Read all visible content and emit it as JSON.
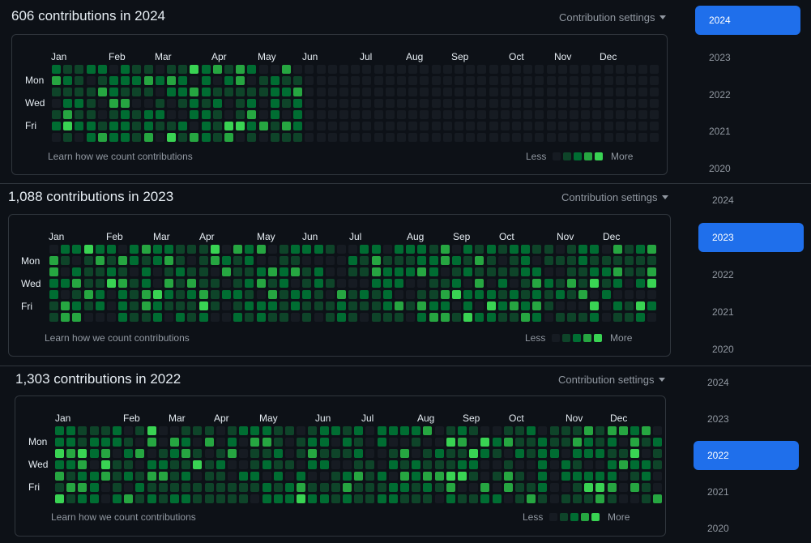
{
  "colors": {
    "accent": "#1f6feb",
    "levels": [
      "#161b22",
      "#0e4429",
      "#006d32",
      "#26a641",
      "#39d353"
    ]
  },
  "months": [
    "Jan",
    "Feb",
    "Mar",
    "Apr",
    "May",
    "Jun",
    "Jul",
    "Aug",
    "Sep",
    "Oct",
    "Nov",
    "Dec"
  ],
  "day_labels": [
    "Mon",
    "Wed",
    "Fri"
  ],
  "learn_link": "Learn how we count contributions",
  "legend": {
    "less": "Less",
    "more": "More"
  },
  "settings_label": "Contribution settings",
  "sections": [
    {
      "title": "606 contributions in 2024",
      "years": [
        "2024",
        "2023",
        "2022",
        "2021",
        "2020"
      ],
      "selected_year": "2024",
      "grid_seed": 11,
      "active_weeks": 22
    },
    {
      "title": "1,088 contributions in 2023",
      "years": [
        "2024",
        "2023",
        "2022",
        "2021",
        "2020"
      ],
      "selected_year": "2023",
      "grid_seed": 23,
      "active_weeks": 53
    },
    {
      "title": "1,303 contributions in 2022",
      "years": [
        "2024",
        "2023",
        "2022",
        "2021",
        "2020"
      ],
      "selected_year": "2022",
      "grid_seed": 37,
      "active_weeks": 53
    }
  ]
}
